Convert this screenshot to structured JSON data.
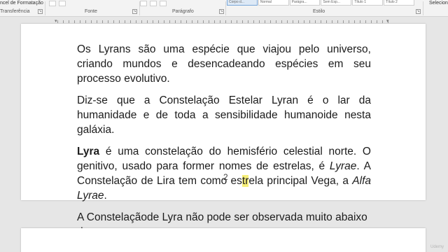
{
  "ribbon": {
    "left_group_top": "ncel de Formatação",
    "groups": [
      "Transferência",
      "Fonte",
      "Parágrafo",
      "Estilo"
    ],
    "styles": [
      "Corpo d...",
      "Normal",
      "Parágra...",
      "Sem Esp...",
      "Título 1",
      "Título 2"
    ],
    "right_label": "Selecion"
  },
  "page": {
    "paragraph1": "Os Lyrans são uma espécie que viajou pelo universo, criando mundos e desencadeando espécies em seu processo evolutivo.",
    "paragraph2": "Diz-se que a Constelação Estelar Lyran é o lar da humanidade e de toda a sensibilidade humanoide nesta galáxia.",
    "paragraph3": {
      "bold": "Lyra",
      "part1": " é uma constelação do hemisfério celestial norte. O genitivo, usado para former nomes de estrelas, é ",
      "italic1": "Lyrae",
      "part2": ". A Constelação de Lira tem como ",
      "highlight_a": "es",
      "highlight_b": "tr",
      "part3": "ela principal Vega, a ",
      "italic2": "Alfa Lyrae",
      "part4": "."
    },
    "paragraph4": "A Constelaçãode Lyra não pode ser observada muito abaixo do",
    "page_number": "2"
  },
  "watermark": "Udemy",
  "colors": {
    "highlight": "#f6ef7a",
    "page": "#ffffff",
    "background": "#e6e6e6"
  }
}
